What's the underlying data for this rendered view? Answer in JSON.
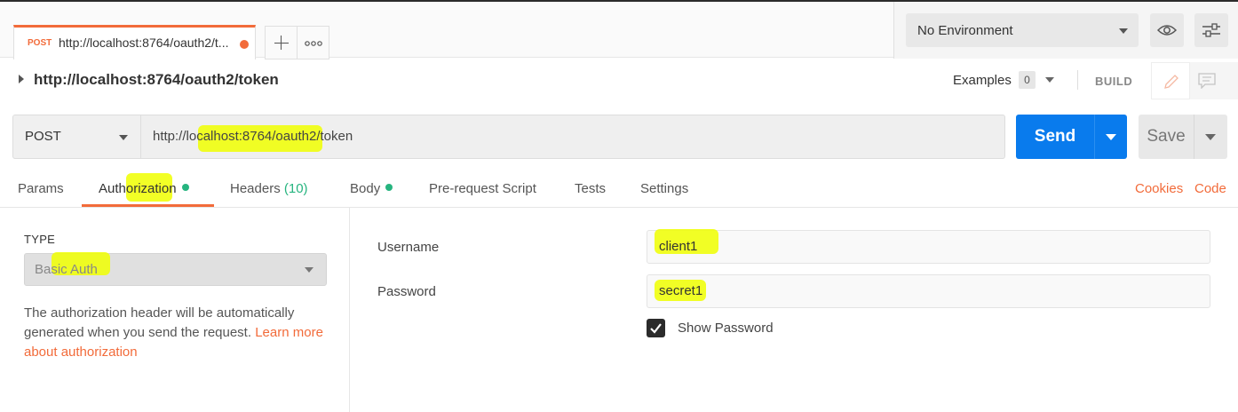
{
  "tabs": [
    {
      "method": "POST",
      "title": "http://localhost:8764/oauth2/t...",
      "unsaved": true
    }
  ],
  "environment": {
    "selected": "No Environment"
  },
  "request": {
    "title": "http://localhost:8764/oauth2/token",
    "examples_label": "Examples",
    "examples_count": "0",
    "build_label": "BUILD",
    "method": "POST",
    "url_parts": [
      "http://lo",
      "calhost:8764/oauth",
      "2/token"
    ],
    "send_label": "Send",
    "save_label": "Save"
  },
  "request_tabs": [
    {
      "label": "Params"
    },
    {
      "label": "Authorization",
      "active": true,
      "dot": true
    },
    {
      "label": "Headers",
      "count": "(10)"
    },
    {
      "label": "Body",
      "dot": true
    },
    {
      "label": "Pre-request Script"
    },
    {
      "label": "Tests"
    },
    {
      "label": "Settings"
    }
  ],
  "right_links": {
    "cookies": "Cookies",
    "code": "Code"
  },
  "auth": {
    "type_label": "TYPE",
    "type_value": "Basic Auth",
    "description": "The authorization header will be automatically generated when you send the request.",
    "learn_more": "Learn more about authorization",
    "username_label": "Username",
    "username_value": "client1",
    "password_label": "Password",
    "password_value": "secret1",
    "show_password_label": "Show Password",
    "show_password_checked": true
  },
  "colors": {
    "accent": "#f26b3a",
    "send": "#097bed",
    "green": "#26b47f",
    "highlight": "#f0ff00"
  },
  "icons": [
    "plus-icon",
    "more-dots-icon",
    "eye-icon",
    "sliders-icon",
    "pencil-icon",
    "comment-icon",
    "check-icon"
  ]
}
